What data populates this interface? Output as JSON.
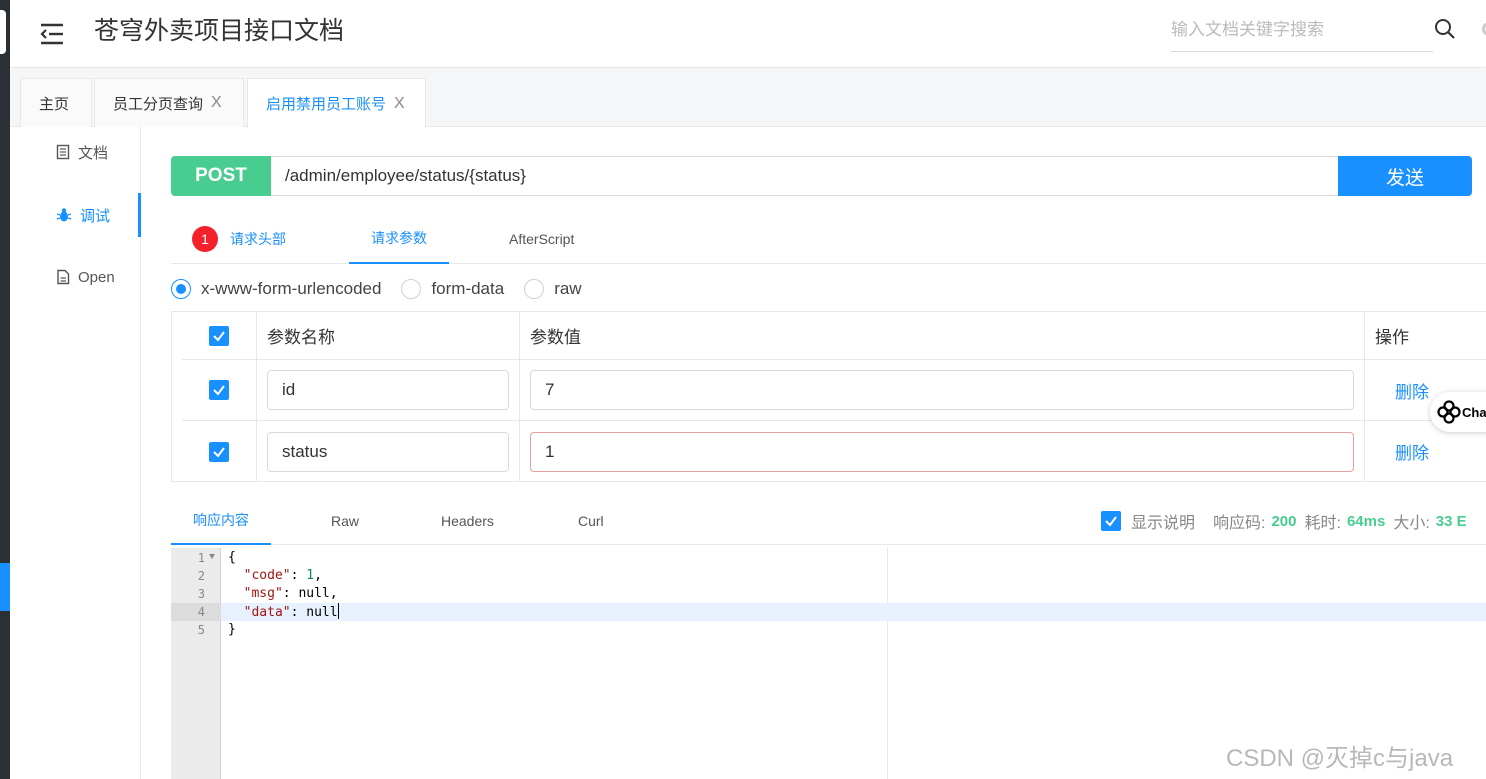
{
  "header": {
    "title": "苍穹外卖项目接口文档",
    "search_placeholder": "输入文档关键字搜索"
  },
  "tabs": [
    {
      "label": "主页",
      "closable": false
    },
    {
      "label": "员工分页查询",
      "closable": true,
      "close": "X"
    },
    {
      "label": "启用禁用员工账号",
      "closable": true,
      "close": "X",
      "active": true
    }
  ],
  "sidebar": {
    "items": [
      {
        "label": "文档",
        "icon": "document-icon"
      },
      {
        "label": "调试",
        "icon": "bug-icon",
        "active": true
      },
      {
        "label": "Open",
        "icon": "file-icon"
      }
    ]
  },
  "request": {
    "method": "POST",
    "url": "/admin/employee/status/{status}",
    "send_label": "发送",
    "tabs": [
      {
        "label": "请求头部",
        "badge": "1"
      },
      {
        "label": "请求参数",
        "active": true
      },
      {
        "label": "AfterScript"
      }
    ],
    "body_types": [
      {
        "label": "x-www-form-urlencoded",
        "checked": true
      },
      {
        "label": "form-data",
        "checked": false
      },
      {
        "label": "raw",
        "checked": false
      }
    ],
    "params_table": {
      "headers": {
        "name": "参数名称",
        "value": "参数值",
        "action": "操作"
      },
      "rows": [
        {
          "checked": true,
          "name": "id",
          "value": "7",
          "action": "删除"
        },
        {
          "checked": true,
          "name": "status",
          "value": "1",
          "action": "删除"
        }
      ]
    }
  },
  "response": {
    "tabs": [
      {
        "label": "响应内容",
        "active": true
      },
      {
        "label": "Raw"
      },
      {
        "label": "Headers"
      },
      {
        "label": "Curl"
      }
    ],
    "show_desc_label": "显示说明",
    "code_label": "响应码:",
    "code_value": "200",
    "time_label": "耗时:",
    "time_value": "64ms",
    "size_label": "大小:",
    "size_value": "33 E",
    "code_lines": [
      {
        "num": "1",
        "text": "{"
      },
      {
        "num": "2",
        "key": "\"code\"",
        "rest": ": ",
        "val": "1",
        "tail": ","
      },
      {
        "num": "3",
        "key": "\"msg\"",
        "rest": ": null,"
      },
      {
        "num": "4",
        "key": "\"data\"",
        "rest": ": null"
      },
      {
        "num": "5",
        "text": "}"
      }
    ]
  },
  "chat_widget": {
    "label": "Cha"
  },
  "watermark": "CSDN @灭掉c与java",
  "colors": {
    "primary": "#1890ff",
    "post": "#49cc90",
    "badge": "#f5222d"
  }
}
